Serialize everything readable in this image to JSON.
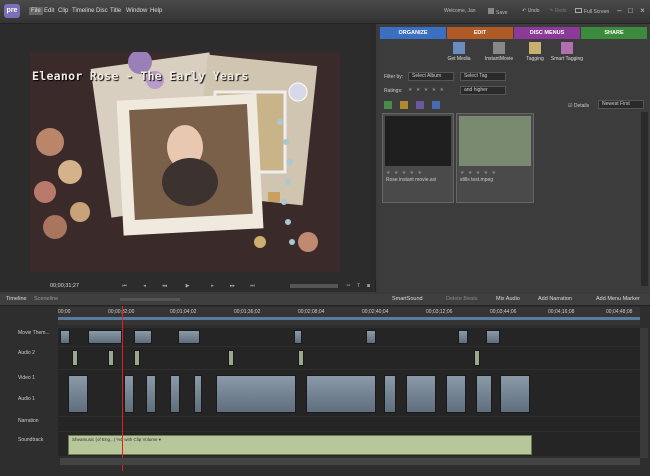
{
  "app": {
    "logo": "pre",
    "menu": [
      "File",
      "Edit",
      "Clip",
      "Timeline",
      "Disc",
      "Title",
      "Window",
      "Help"
    ],
    "user": "Welcome, Jan",
    "toolbar": {
      "save": "Save",
      "undo": "Undo",
      "redo": "Redo",
      "fullscreen": "Full Screen"
    }
  },
  "preview": {
    "title_text": "Eleanor Rose - The Early Years",
    "timecode": "00;00;31;27"
  },
  "organizer": {
    "tabs": [
      {
        "label": "ORGANIZE",
        "color": "#3a6fc2"
      },
      {
        "label": "EDIT",
        "color": "#b05a26"
      },
      {
        "label": "DISC MENUS",
        "color": "#8c3a98"
      },
      {
        "label": "SHARE",
        "color": "#3c8a3c"
      }
    ],
    "tools": [
      "Get Media",
      "InstantMovie",
      "Tagging",
      "Smart Tagging"
    ],
    "filter_label": "Filter by:",
    "album_select": "Select Album",
    "tag_select": "Select Tag",
    "ratings_label": "Ratings:",
    "higher_select": "and higher",
    "details_label": "Details",
    "sort_select": "Newest First",
    "items": [
      {
        "name": "Rose instant movie.avi"
      },
      {
        "name": "stills test.mpeg"
      }
    ]
  },
  "timeline": {
    "tabs": [
      "Timeline",
      "Sceneline"
    ],
    "tools": [
      "SmartSound",
      "Delete Beats",
      "Mix Audio",
      "Add Narration",
      "Add Menu Marker"
    ],
    "ruler": [
      "00;00",
      "00;00;32;00",
      "00;01;04;02",
      "00;01;36;02",
      "00;02;08;04",
      "00;02;40;04",
      "00;03;12;06",
      "00;03;44;06",
      "00;04;16;08",
      "00;04;48;08"
    ],
    "tracks": [
      "Movie Them...",
      "Audio 2",
      "Video 1",
      "Audio 1",
      "Narration",
      "Soundtrack"
    ],
    "soundtrack_clip": "Sheamusic (of Eng...) %0 with Clip Volume ▾"
  }
}
